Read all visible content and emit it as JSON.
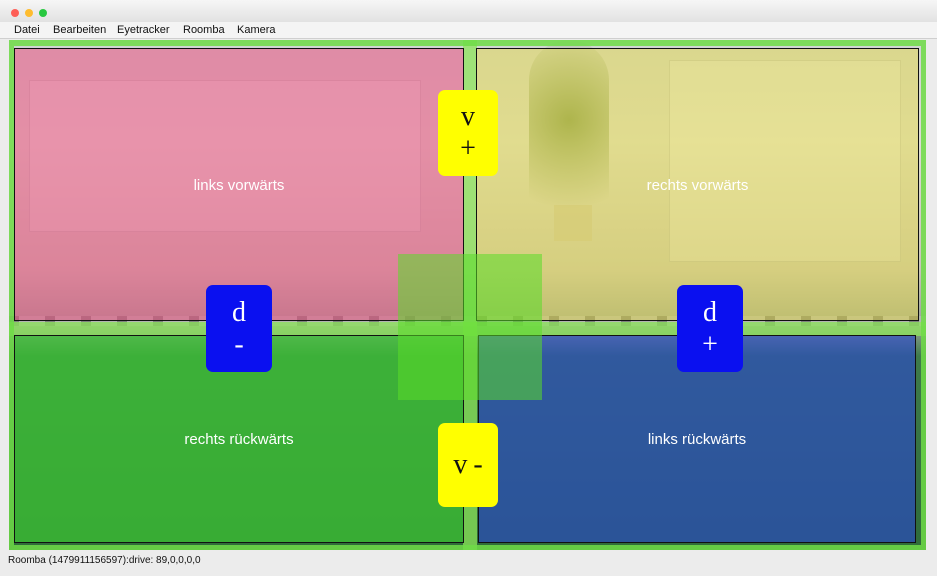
{
  "menu": [
    "Datei",
    "Bearbeiten",
    "Eyetracker",
    "Roomba",
    "Kamera"
  ],
  "zones": {
    "top_left": "links vorwärts",
    "top_right": "rechts vorwärts",
    "bottom_left": "rechts rückwärts",
    "bottom_right": "links rückwärts"
  },
  "buttons": {
    "speed_up": {
      "top": "v",
      "bottom": "+"
    },
    "speed_down": {
      "top": "v",
      "bottom": "-"
    },
    "dir_minus": {
      "top": "d",
      "bottom": "-"
    },
    "dir_plus": {
      "top": "d",
      "bottom": "+"
    }
  },
  "status": "Roomba (1479911156597):drive: 89,0,0,0,0",
  "colors": {
    "close": "#fe5f57",
    "minimize": "#febc2e",
    "zoom": "#28c840",
    "yellow_button": "#ffff00",
    "blue_button": "#0a10f0"
  }
}
